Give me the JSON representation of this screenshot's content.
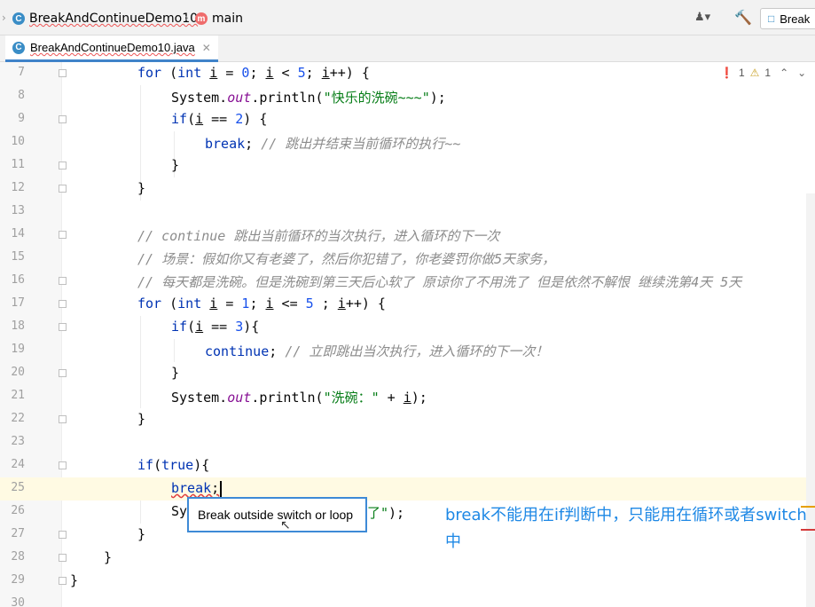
{
  "breadcrumb": {
    "class_name": "BreakAndContinueDemo10",
    "class_icon": "C",
    "method_name": "main",
    "method_icon": "m"
  },
  "toolbar": {
    "run_config_label": "Break"
  },
  "tabs": [
    {
      "label": "BreakAndContinueDemo10.java",
      "icon": "C"
    }
  ],
  "inspections": {
    "errors": "1",
    "warnings": "1"
  },
  "editor": {
    "line_numbers": [
      "7",
      "8",
      "9",
      "10",
      "11",
      "12",
      "13",
      "14",
      "15",
      "16",
      "17",
      "18",
      "19",
      "20",
      "21",
      "22",
      "23",
      "24",
      "25",
      "26",
      "27",
      "28",
      "29",
      "30"
    ],
    "current_line": "25"
  },
  "code_text": {
    "l7_for": "for",
    "l7_int": "int",
    "l7_a": " (",
    "l7_b": " ",
    "l7_i": "i",
    "l7_c": " = ",
    "l7_zero": "0",
    "l7_d": "; ",
    "l7_i2": "i",
    "l7_e": " < ",
    "l7_five": "5",
    "l7_f": "; ",
    "l7_i3": "i",
    "l7_g": "++) {",
    "l8_a": "System.",
    "l8_out": "out",
    "l8_b": ".println(",
    "l8_str": "\"快乐的洗碗~~~\"",
    "l8_c": ");",
    "l9_if": "if",
    "l9_a": "(",
    "l9_i": "i",
    "l9_b": " == ",
    "l9_two": "2",
    "l9_c": ") {",
    "l10_break": "break",
    "l10_a": "; ",
    "l10_cm": "// 跳出并结束当前循环的执行~~",
    "l11": "}",
    "l12": "}",
    "l14_cm": "// continue 跳出当前循环的当次执行，进入循环的下一次",
    "l15_cm": "// 场景：假如你又有老婆了，然后你犯错了，你老婆罚你做5天家务，",
    "l16_cm": "// 每天都是洗碗。但是洗碗到第三天后心软了 原谅你了不用洗了 但是依然不解恨 继续洗第4天 5天",
    "l17_for": "for",
    "l17_int": "int",
    "l17_a": " (",
    "l17_b": " ",
    "l17_i": "i",
    "l17_c": " = ",
    "l17_one": "1",
    "l17_d": "; ",
    "l17_i2": "i",
    "l17_e": " <= ",
    "l17_five": "5",
    "l17_f": " ; ",
    "l17_i3": "i",
    "l17_g": "++) {",
    "l18_if": "if",
    "l18_a": "(",
    "l18_i": "i",
    "l18_b": " == ",
    "l18_three": "3",
    "l18_c": "){",
    "l19_continue": "continue",
    "l19_a": "; ",
    "l19_cm": "// 立即跳出当次执行，进入循环的下一次！",
    "l20": "}",
    "l21_a": "System.",
    "l21_out": "out",
    "l21_b": ".println(",
    "l21_str": "\"洗碗：\"",
    "l21_c": " + ",
    "l21_i": "i",
    "l21_d": ");",
    "l22": "}",
    "l24_if": "if",
    "l24_a": "(",
    "l24_true": "true",
    "l24_b": "){",
    "l25_break": "break",
    "l25_a": ";",
    "l26_a": "Sy",
    "l26_str": "了\"",
    "l26_b": ");",
    "l27": "}",
    "l28": "}",
    "l29": "}"
  },
  "tooltip": {
    "text": "Break outside switch or loop"
  },
  "annotation": {
    "text": "break不能用在if判断中，只能用在循环或者switch中",
    "color": "#1e88e5"
  }
}
